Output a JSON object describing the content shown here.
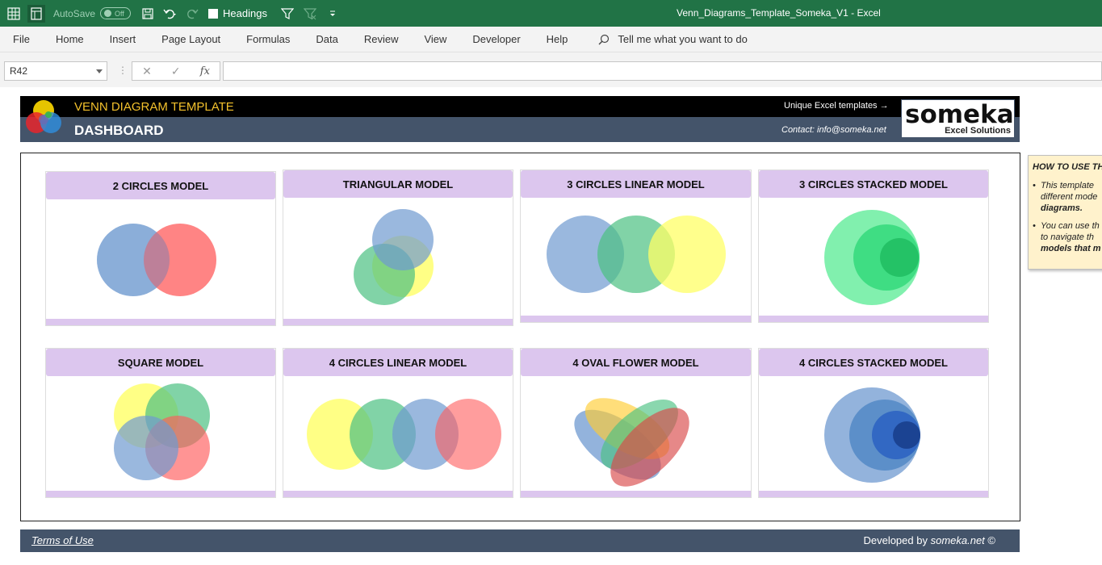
{
  "titlebar": {
    "autosave_label": "AutoSave",
    "autosave_state": "Off",
    "headings_label": "Headings",
    "doc_title": "Venn_Diagrams_Template_Someka_V1  -  Excel"
  },
  "menu": [
    "File",
    "Home",
    "Insert",
    "Page Layout",
    "Formulas",
    "Data",
    "Review",
    "View",
    "Developer",
    "Help"
  ],
  "tell_me": "Tell me what you want to do",
  "formula_bar": {
    "name_box": "R42",
    "fx": "fx",
    "value": ""
  },
  "header": {
    "title": "VENN DIAGRAM TEMPLATE",
    "subtitle": "DASHBOARD",
    "unique": "Unique Excel templates →",
    "contact": "Contact: info@someka.net",
    "logo_word": "someka",
    "logo_sub": "Excel Solutions"
  },
  "cards": [
    "2 CIRCLES MODEL",
    "TRIANGULAR MODEL",
    "3 CIRCLES LINEAR MODEL",
    "3 CIRCLES STACKED MODEL",
    "SQUARE MODEL",
    "4 CIRCLES LINEAR MODEL",
    "4 OVAL FLOWER MODEL",
    "4 CIRCLES STACKED MODEL"
  ],
  "colors": {
    "blue": "#6f9ad0",
    "red": "#ff5b5b",
    "green": "#4cc182",
    "yellow": "#ffff66",
    "card_header": "#dcc6ee",
    "excel_green": "#217346",
    "slate": "#44546a"
  },
  "footer": {
    "terms": "Terms of Use",
    "developed_prefix": "Developed by ",
    "developed_brand": "someka.net",
    "developed_suffix": " ©"
  },
  "howto": {
    "title": "HOW TO USE TH",
    "item1_line1": "This template",
    "item1_line2": "different mode",
    "item1_line3": "diagrams.",
    "item2_line1": "You can use th",
    "item2_line2": "to navigate th",
    "item2_line3": "models that m"
  }
}
